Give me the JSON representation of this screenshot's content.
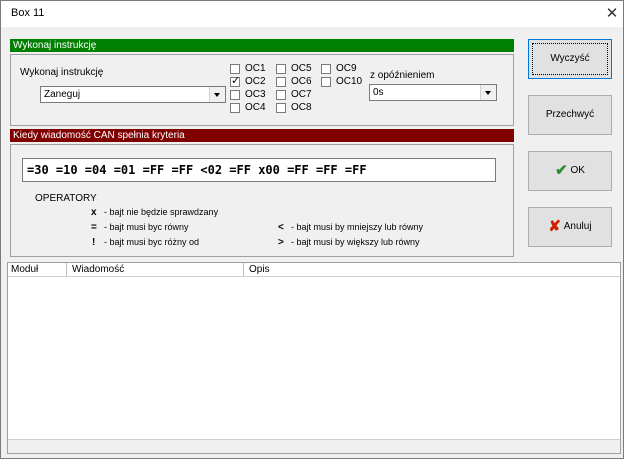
{
  "window": {
    "title": "Box 11",
    "close_glyph": "✕"
  },
  "section1": {
    "header": "Wykonaj instrukcję",
    "label": "Wykonaj instrukcję",
    "instruction_value": "Zaneguj",
    "checkboxes": [
      {
        "label": "OC1",
        "checked": false
      },
      {
        "label": "OC2",
        "checked": true
      },
      {
        "label": "OC3",
        "checked": false
      },
      {
        "label": "OC4",
        "checked": false
      },
      {
        "label": "OC5",
        "checked": false
      },
      {
        "label": "OC6",
        "checked": false
      },
      {
        "label": "OC7",
        "checked": false
      },
      {
        "label": "OC8",
        "checked": false
      },
      {
        "label": "OC9",
        "checked": false
      },
      {
        "label": "OC10",
        "checked": false
      }
    ],
    "delay_label": "z opóźnieniem",
    "delay_value": "0s"
  },
  "section2": {
    "header": "Kiedy wiadomość CAN spełnia kryteria",
    "criteria": "=30 =10 =04 =01 =FF =FF <02 =FF x00 =FF =FF =FF",
    "operators_title": "OPERATORY",
    "operators": [
      {
        "symbol": "x",
        "desc": "- bajt nie będzie sprawdzany"
      },
      {
        "symbol": "=",
        "desc": "- bajt musi byc równy"
      },
      {
        "symbol": "!",
        "desc": "- bajt musi byc różny od"
      },
      {
        "symbol": "<",
        "desc": "- bajt musi by mniejszy lub równy"
      },
      {
        "symbol": ">",
        "desc": "- bajt musi by większy lub równy"
      }
    ]
  },
  "buttons": {
    "clear": "Wyczyść",
    "capture": "Przechwyć",
    "ok": "OK",
    "cancel": "Anuluj"
  },
  "table": {
    "columns": [
      "Moduł",
      "Wiadomość",
      "Opis"
    ]
  },
  "colors": {
    "green_bar": "#008000",
    "red_bar": "#800000",
    "ok_check": "#2e8b2e",
    "cancel_x": "#cc2200"
  }
}
